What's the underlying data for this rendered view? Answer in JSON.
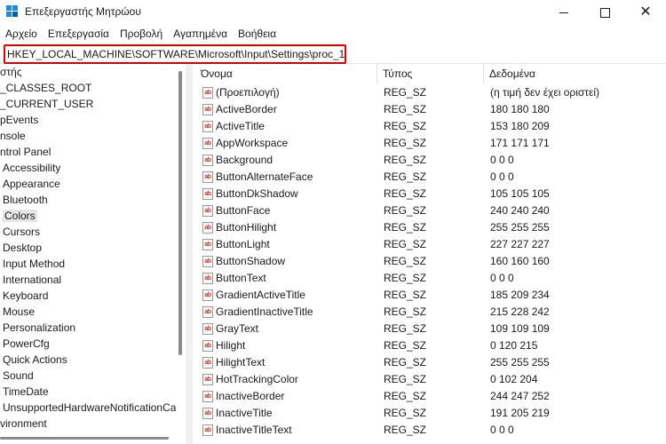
{
  "window": {
    "title": "Επεξεργαστής Μητρώου"
  },
  "menu": [
    "Αρχείο",
    "Επεξεργασία",
    "Προβολή",
    "Αγαπημένα",
    "Βοήθεια"
  ],
  "address": {
    "value": "HKEY_LOCAL_MACHINE\\SOFTWARE\\Microsoft\\Input\\Settings\\proc_1"
  },
  "tree": [
    {
      "label": "στής",
      "selected": false
    },
    {
      "label": "_CLASSES_ROOT",
      "selected": false
    },
    {
      "label": "_CURRENT_USER",
      "selected": false
    },
    {
      "label": "pEvents",
      "selected": false
    },
    {
      "label": "nsole",
      "selected": false
    },
    {
      "label": "ntrol Panel",
      "selected": false
    },
    {
      "label": "Accessibility",
      "selected": false
    },
    {
      "label": "Appearance",
      "selected": false
    },
    {
      "label": "Bluetooth",
      "selected": false
    },
    {
      "label": "Colors",
      "selected": true
    },
    {
      "label": "Cursors",
      "selected": false
    },
    {
      "label": "Desktop",
      "selected": false
    },
    {
      "label": "Input Method",
      "selected": false
    },
    {
      "label": "International",
      "selected": false
    },
    {
      "label": "Keyboard",
      "selected": false
    },
    {
      "label": "Mouse",
      "selected": false
    },
    {
      "label": "Personalization",
      "selected": false
    },
    {
      "label": "PowerCfg",
      "selected": false
    },
    {
      "label": "Quick Actions",
      "selected": false
    },
    {
      "label": "Sound",
      "selected": false
    },
    {
      "label": "TimeDate",
      "selected": false
    },
    {
      "label": "UnsupportedHardwareNotificationCa",
      "selected": false
    },
    {
      "label": "vironment",
      "selected": false
    }
  ],
  "columns": {
    "name": "Όνομα",
    "type": "Τύπος",
    "data": "Δεδομένα"
  },
  "values": [
    {
      "name": "(Προεπιλογή)",
      "type": "REG_SZ",
      "data": "(η τιμή δεν έχει οριστεί)"
    },
    {
      "name": "ActiveBorder",
      "type": "REG_SZ",
      "data": "180 180 180"
    },
    {
      "name": "ActiveTitle",
      "type": "REG_SZ",
      "data": "153 180 209"
    },
    {
      "name": "AppWorkspace",
      "type": "REG_SZ",
      "data": "171 171 171"
    },
    {
      "name": "Background",
      "type": "REG_SZ",
      "data": "0 0 0"
    },
    {
      "name": "ButtonAlternateFace",
      "type": "REG_SZ",
      "data": "0 0 0"
    },
    {
      "name": "ButtonDkShadow",
      "type": "REG_SZ",
      "data": "105 105 105"
    },
    {
      "name": "ButtonFace",
      "type": "REG_SZ",
      "data": "240 240 240"
    },
    {
      "name": "ButtonHilight",
      "type": "REG_SZ",
      "data": "255 255 255"
    },
    {
      "name": "ButtonLight",
      "type": "REG_SZ",
      "data": "227 227 227"
    },
    {
      "name": "ButtonShadow",
      "type": "REG_SZ",
      "data": "160 160 160"
    },
    {
      "name": "ButtonText",
      "type": "REG_SZ",
      "data": "0 0 0"
    },
    {
      "name": "GradientActiveTitle",
      "type": "REG_SZ",
      "data": "185 209 234"
    },
    {
      "name": "GradientInactiveTitle",
      "type": "REG_SZ",
      "data": "215 228 242"
    },
    {
      "name": "GrayText",
      "type": "REG_SZ",
      "data": "109 109 109"
    },
    {
      "name": "Hilight",
      "type": "REG_SZ",
      "data": "0 120 215"
    },
    {
      "name": "HilightText",
      "type": "REG_SZ",
      "data": "255 255 255"
    },
    {
      "name": "HotTrackingColor",
      "type": "REG_SZ",
      "data": "0 102 204"
    },
    {
      "name": "InactiveBorder",
      "type": "REG_SZ",
      "data": "244 247 252"
    },
    {
      "name": "InactiveTitle",
      "type": "REG_SZ",
      "data": "191 205 219"
    },
    {
      "name": "InactiveTitleText",
      "type": "REG_SZ",
      "data": "0 0 0"
    }
  ],
  "colors": {
    "address_highlight": "#d40000",
    "selection": "#e6e6e6",
    "app_icon": "#1f8ad6"
  },
  "icons": {
    "value": "reg-sz-icon",
    "app": "registry-editor-icon"
  }
}
